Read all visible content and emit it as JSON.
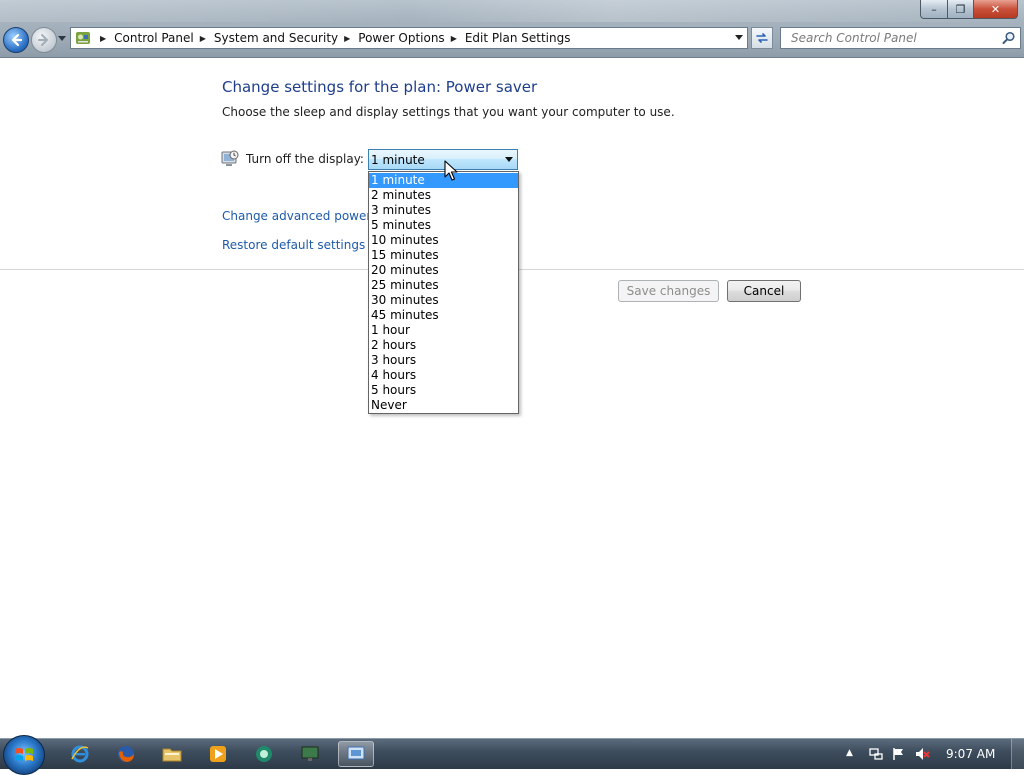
{
  "window": {
    "minimize_glyph": "–",
    "maximize_glyph": "❐",
    "close_glyph": "✕"
  },
  "breadcrumb": [
    {
      "label": "Control Panel"
    },
    {
      "label": "System and Security"
    },
    {
      "label": "Power Options"
    },
    {
      "label": "Edit Plan Settings"
    }
  ],
  "search": {
    "placeholder": "Search Control Panel"
  },
  "main": {
    "title": "Change settings for the plan: Power saver",
    "subtitle": "Choose the sleep and display settings that you want your computer to use.",
    "display_label": "Turn off the display:",
    "display_value": "1 minute",
    "options": [
      "1 minute",
      "2 minutes",
      "3 minutes",
      "5 minutes",
      "10 minutes",
      "15 minutes",
      "20 minutes",
      "25 minutes",
      "30 minutes",
      "45 minutes",
      "1 hour",
      "2 hours",
      "3 hours",
      "4 hours",
      "5 hours",
      "Never"
    ],
    "selected_index": 0,
    "link_advanced": "Change advanced power settings",
    "link_restore": "Restore default settings for this plan",
    "save_label": "Save changes",
    "cancel_label": "Cancel"
  },
  "taskbar": {
    "clock": "9:07 AM"
  },
  "colors": {
    "title": "#1e3e8c",
    "link": "#1e5aa8",
    "selection": "#3399ff"
  }
}
